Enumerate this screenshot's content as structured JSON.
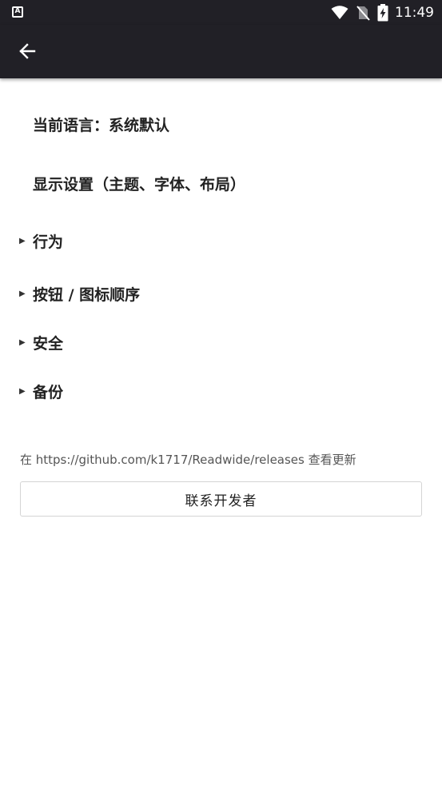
{
  "status_bar": {
    "app_icon_letter": "A",
    "time": "11:49",
    "icons": [
      "wifi-icon",
      "no-sim-icon",
      "battery-charging-icon"
    ]
  },
  "app_bar": {
    "back_icon": "arrow-left-icon"
  },
  "settings": {
    "language_label": "当前语言：系统默认",
    "display_label": "显示设置（主题、字体、布局）",
    "sections": [
      {
        "label": "行为"
      },
      {
        "label": "按钮 / 图标顺序"
      },
      {
        "label": "安全"
      },
      {
        "label": "备份"
      }
    ],
    "update_text": "在 https://github.com/k1717/Readwide/releases 查看更新",
    "contact_button": "联系开发者"
  },
  "colors": {
    "bar_background": "#212026",
    "page_background": "#ffffff"
  }
}
